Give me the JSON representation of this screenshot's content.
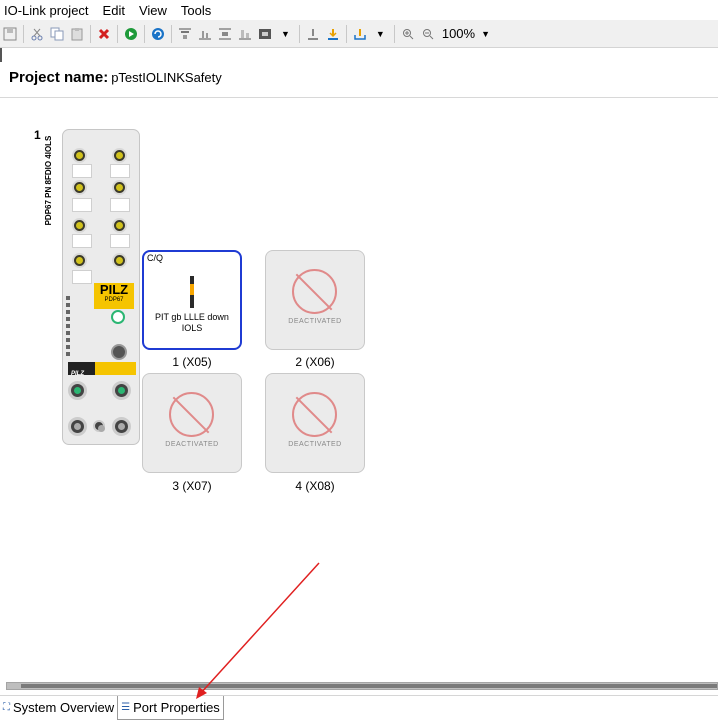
{
  "menu": {
    "items": [
      "IO-Link project",
      "Edit",
      "View",
      "Tools"
    ]
  },
  "toolbar": {
    "icons": [
      "save-icon",
      "cut-icon",
      "copy-icon",
      "paste-icon",
      "delete-icon",
      "play-icon",
      "refresh-icon",
      "align-top-icon",
      "align-middle-icon",
      "align-center-icon",
      "align-bottom-icon",
      "device-icon",
      "upload-icon",
      "download-icon",
      "export-icon",
      "zoom-in-icon",
      "zoom-out-icon"
    ],
    "zoom": "100%",
    "colors": {
      "delete": "#d32020",
      "play": "#1e9a3a",
      "refresh": "#1a73c7"
    }
  },
  "project": {
    "label": "Project name:",
    "name": "pTestIOLINKSafety"
  },
  "module": {
    "slot_number": "1",
    "vertical_label": "PDP67 PN 8FDIO 4IOLS",
    "brand": "PILZ",
    "brand_sub": "PDP67",
    "brand_color": "#f5c400"
  },
  "ports": [
    {
      "label": "1 (X05)",
      "state": "active",
      "signal": "C/Q",
      "device": "PIT gb LLLE down IOLS"
    },
    {
      "label": "2 (X06)",
      "state": "deactivated",
      "status": "DEACTIVATED"
    },
    {
      "label": "3 (X07)",
      "state": "deactivated",
      "status": "DEACTIVATED"
    },
    {
      "label": "4 (X08)",
      "state": "deactivated",
      "status": "DEACTIVATED"
    }
  ],
  "bottom_tabs": [
    {
      "label": "System Overview",
      "icon": "network-icon",
      "selected": false
    },
    {
      "label": "Port Properties",
      "icon": "list-icon",
      "selected": true
    }
  ],
  "annotation": {
    "arrow_color": "#e02020"
  }
}
